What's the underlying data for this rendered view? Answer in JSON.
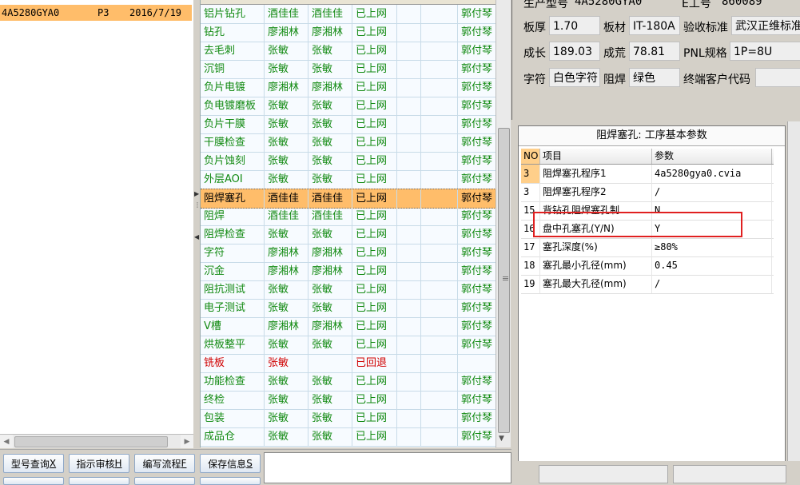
{
  "left_list": {
    "rows": [
      {
        "model": "4A5280GYA0",
        "layer": "P3",
        "date": "2016/7/19"
      }
    ]
  },
  "process_table": {
    "rows": [
      {
        "process": "铝片钻孔",
        "a": "酒佳佳",
        "b": "酒佳佳",
        "status": "已上网",
        "e": "",
        "f": "",
        "owner": "郭付琴",
        "color": "green"
      },
      {
        "process": "钻孔",
        "a": "廖湘林",
        "b": "廖湘林",
        "status": "已上网",
        "e": "",
        "f": "",
        "owner": "郭付琴",
        "color": "green"
      },
      {
        "process": "去毛刺",
        "a": "张敏",
        "b": "张敏",
        "status": "已上网",
        "e": "",
        "f": "",
        "owner": "郭付琴",
        "color": "green"
      },
      {
        "process": "沉铜",
        "a": "张敏",
        "b": "张敏",
        "status": "已上网",
        "e": "",
        "f": "",
        "owner": "郭付琴",
        "color": "green"
      },
      {
        "process": "负片电镀",
        "a": "廖湘林",
        "b": "廖湘林",
        "status": "已上网",
        "e": "",
        "f": "",
        "owner": "郭付琴",
        "color": "green"
      },
      {
        "process": "负电镀磨板",
        "a": "张敏",
        "b": "张敏",
        "status": "已上网",
        "e": "",
        "f": "",
        "owner": "郭付琴",
        "color": "green"
      },
      {
        "process": "负片干膜",
        "a": "张敏",
        "b": "张敏",
        "status": "已上网",
        "e": "",
        "f": "",
        "owner": "郭付琴",
        "color": "green"
      },
      {
        "process": "干膜检查",
        "a": "张敏",
        "b": "张敏",
        "status": "已上网",
        "e": "",
        "f": "",
        "owner": "郭付琴",
        "color": "green"
      },
      {
        "process": "负片蚀刻",
        "a": "张敏",
        "b": "张敏",
        "status": "已上网",
        "e": "",
        "f": "",
        "owner": "郭付琴",
        "color": "green"
      },
      {
        "process": "外层AOI",
        "a": "张敏",
        "b": "张敏",
        "status": "已上网",
        "e": "",
        "f": "",
        "owner": "郭付琴",
        "color": "green"
      },
      {
        "process": "阻焊塞孔",
        "a": "酒佳佳",
        "b": "酒佳佳",
        "status": "已上网",
        "e": "",
        "f": "",
        "owner": "郭付琴",
        "color": "dark",
        "selected": true
      },
      {
        "process": "阻焊",
        "a": "酒佳佳",
        "b": "酒佳佳",
        "status": "已上网",
        "e": "",
        "f": "",
        "owner": "郭付琴",
        "color": "green"
      },
      {
        "process": "阻焊检查",
        "a": "张敏",
        "b": "张敏",
        "status": "已上网",
        "e": "",
        "f": "",
        "owner": "郭付琴",
        "color": "green"
      },
      {
        "process": "字符",
        "a": "廖湘林",
        "b": "廖湘林",
        "status": "已上网",
        "e": "",
        "f": "",
        "owner": "郭付琴",
        "color": "green"
      },
      {
        "process": "沉金",
        "a": "廖湘林",
        "b": "廖湘林",
        "status": "已上网",
        "e": "",
        "f": "",
        "owner": "郭付琴",
        "color": "green"
      },
      {
        "process": "阻抗测试",
        "a": "张敏",
        "b": "张敏",
        "status": "已上网",
        "e": "",
        "f": "",
        "owner": "郭付琴",
        "color": "green"
      },
      {
        "process": "电子测试",
        "a": "张敏",
        "b": "张敏",
        "status": "已上网",
        "e": "",
        "f": "",
        "owner": "郭付琴",
        "color": "green"
      },
      {
        "process": "V槽",
        "a": "廖湘林",
        "b": "廖湘林",
        "status": "已上网",
        "e": "",
        "f": "",
        "owner": "郭付琴",
        "color": "green"
      },
      {
        "process": "烘板整平",
        "a": "张敏",
        "b": "张敏",
        "status": "已上网",
        "e": "",
        "f": "",
        "owner": "郭付琴",
        "color": "green"
      },
      {
        "process": "铣板",
        "a": "张敏",
        "b": "",
        "status": "已回退",
        "e": "",
        "f": "",
        "owner": "",
        "color": "red"
      },
      {
        "process": "功能检查",
        "a": "张敏",
        "b": "张敏",
        "status": "已上网",
        "e": "",
        "f": "",
        "owner": "郭付琴",
        "color": "green"
      },
      {
        "process": "终检",
        "a": "张敏",
        "b": "张敏",
        "status": "已上网",
        "e": "",
        "f": "",
        "owner": "郭付琴",
        "color": "green"
      },
      {
        "process": "包装",
        "a": "张敏",
        "b": "张敏",
        "status": "已上网",
        "e": "",
        "f": "",
        "owner": "郭付琴",
        "color": "green"
      },
      {
        "process": "成品仓",
        "a": "张敏",
        "b": "张敏",
        "status": "已上网",
        "e": "",
        "f": "",
        "owner": "郭付琴",
        "color": "green"
      }
    ]
  },
  "buttons": [
    {
      "label": "型号查询",
      "key": "X"
    },
    {
      "label": "指示审核",
      "key": "H"
    },
    {
      "label": "编写流程",
      "key": "F"
    },
    {
      "label": "保存信息",
      "key": "S"
    }
  ],
  "info": {
    "top_partial": {
      "model_label": "生产型号",
      "model_value": "4A5280GYA0",
      "e_label": "E工号",
      "e_value": "860089"
    },
    "thickness": {
      "label": "板厚",
      "value": "1.70"
    },
    "material": {
      "label": "板材",
      "value": "IT-180A"
    },
    "standard": {
      "label": "验收标准",
      "value": "武汉正维标准"
    },
    "growth": {
      "label": "成长",
      "value": "189.03"
    },
    "finished": {
      "label": "成荒",
      "value": "78.81"
    },
    "pnl": {
      "label": "PNL规格",
      "value": "1P=8U"
    },
    "char": {
      "label": "字符",
      "value": "白色字符"
    },
    "mask": {
      "label": "阻焊",
      "value": "绿色"
    },
    "customer": {
      "label": "终端客户代码",
      "value": ""
    }
  },
  "params": {
    "title": "阻焊塞孔: 工序基本参数",
    "headers": {
      "no": "NO",
      "item": "项目",
      "value": "参数"
    },
    "rows": [
      {
        "no": "3",
        "item": "阻焊塞孔程序1",
        "value": "4a5280gya0.cvia"
      },
      {
        "no": "3",
        "item": "阻焊塞孔程序2",
        "value": "/"
      },
      {
        "no": "15",
        "item": "背钻孔阻焊塞孔制...",
        "value": "N"
      },
      {
        "no": "16",
        "item": "盘中孔塞孔(Y/N)",
        "value": "Y"
      },
      {
        "no": "17",
        "item": "塞孔深度(%)",
        "value": "≥80%"
      },
      {
        "no": "18",
        "item": "塞孔最小孔径(mm)",
        "value": "0.45"
      },
      {
        "no": "19",
        "item": "塞孔最大孔径(mm)",
        "value": "/"
      }
    ]
  }
}
